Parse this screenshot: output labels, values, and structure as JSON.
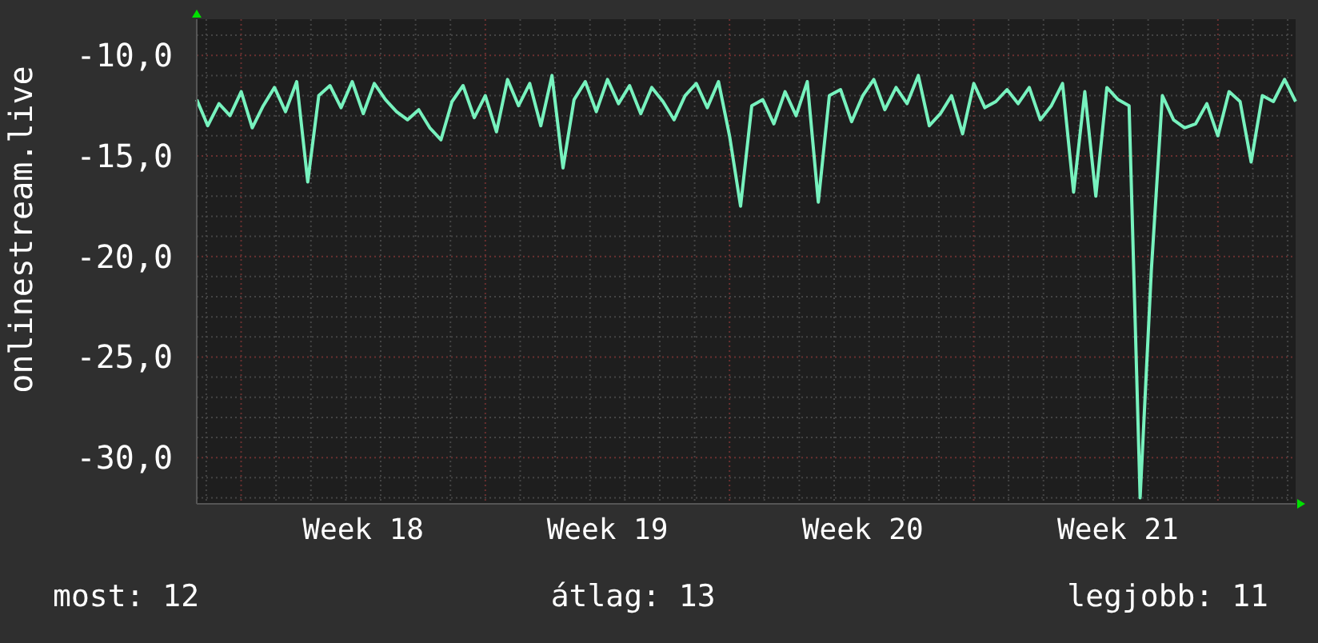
{
  "chart": {
    "chart_data": {
      "type": "line",
      "ylabel": "onlinestream.live",
      "grid": true,
      "categories": [
        null,
        null,
        null,
        null,
        null,
        null,
        null,
        null,
        null,
        null,
        null,
        null,
        null,
        null,
        null,
        "Week 18",
        null,
        null,
        null,
        null,
        null,
        null,
        null,
        null,
        null,
        null,
        null,
        null,
        null,
        null,
        null,
        null,
        null,
        null,
        null,
        null,
        null,
        "Week 19",
        null,
        null,
        null,
        null,
        null,
        null,
        null,
        null,
        null,
        null,
        null,
        null,
        null,
        null,
        null,
        null,
        null,
        null,
        null,
        null,
        null,
        null,
        "Week 20",
        null,
        null,
        null,
        null,
        null,
        null,
        null,
        null,
        null,
        null,
        null,
        null,
        null,
        null,
        null,
        null,
        null,
        null,
        null,
        null,
        null,
        null,
        "Week 21",
        null,
        null,
        null,
        null,
        null,
        null,
        null,
        null,
        null,
        null,
        null,
        null,
        null,
        null,
        null,
        null
      ],
      "ylim": [
        -32.3,
        -8.2
      ],
      "yticks": [
        {
          "value": -10,
          "label": "-10,0"
        },
        {
          "value": -15,
          "label": "-15,0"
        },
        {
          "value": -20,
          "label": "-20,0"
        },
        {
          "value": -25,
          "label": "-25,0"
        },
        {
          "value": -30,
          "label": "-30,0"
        }
      ],
      "series": [
        {
          "color": "#77f2be",
          "values": [
            -12.2,
            -13.5,
            -12.4,
            -13,
            -11.8,
            -13.6,
            -12.5,
            -11.6,
            -12.8,
            -11.3,
            -16.3,
            -12.0,
            -11.5,
            -12.6,
            -11.3,
            -12.9,
            -11.4,
            -12.2,
            -12.8,
            -13.2,
            -12.7,
            -13.6,
            -14.2,
            -12.3,
            -11.5,
            -13.1,
            -12.0,
            -13.8,
            -11.2,
            -12.5,
            -11.4,
            -13.5,
            -11.0,
            -15.6,
            -12.2,
            -11.3,
            -12.8,
            -11.2,
            -12.4,
            -11.5,
            -12.9,
            -11.6,
            -12.3,
            -13.2,
            -12.0,
            -11.4,
            -12.6,
            -11.3,
            -14.0,
            -17.5,
            -12.5,
            -12.2,
            -13.4,
            -11.8,
            -13.0,
            -11.3,
            -17.3,
            -12.0,
            -11.7,
            -13.3,
            -12.0,
            -11.2,
            -12.7,
            -11.6,
            -12.4,
            -11.0,
            -13.5,
            -12.9,
            -12.0,
            -13.9,
            -11.4,
            -12.6,
            -12.3,
            -11.7,
            -12.4,
            -11.6,
            -13.2,
            -12.5,
            -11.4,
            -16.8,
            -11.8,
            -17.0,
            -11.6,
            -12.2,
            -12.5,
            -32.0,
            -20.7,
            -12.0,
            -13.2,
            -13.6,
            -13.4,
            -12.4,
            -14.0,
            -11.8,
            -12.3,
            -15.3,
            -12.0,
            -12.3,
            -11.2,
            -12.3
          ]
        }
      ]
    }
  },
  "stats": [
    "most: 12",
    "átlag: 13",
    "legjobb: 11"
  ]
}
